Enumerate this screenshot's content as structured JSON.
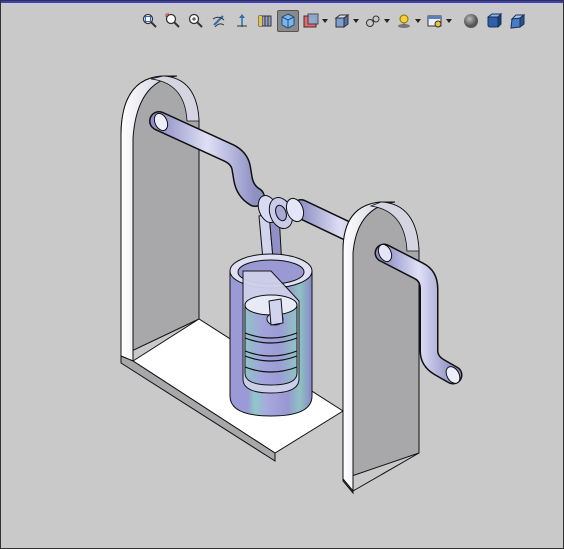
{
  "window": {
    "background": "#c9c9c9",
    "accent_line": "#3e3ec8"
  },
  "toolbar": {
    "buttons": [
      {
        "name": "zoom-to-fit-icon",
        "menu": false,
        "active": false
      },
      {
        "name": "zoom-to-area-icon",
        "menu": false,
        "active": false
      },
      {
        "name": "zoom-in-out-icon",
        "menu": false,
        "active": false
      },
      {
        "name": "rotate-view-icon",
        "menu": false,
        "active": false
      },
      {
        "name": "pan-icon",
        "menu": false,
        "active": false
      },
      {
        "name": "section-view-icon",
        "menu": false,
        "active": false
      },
      {
        "name": "view-orientation-icon",
        "menu": false,
        "active": true
      },
      {
        "name": "display-style-icon",
        "menu": true,
        "active": false
      },
      {
        "name": "hide-show-items-icon",
        "menu": true,
        "active": false
      },
      {
        "name": "edit-appearance-icon",
        "menu": true,
        "active": false
      },
      {
        "name": "apply-scene-icon",
        "menu": true,
        "active": false
      },
      {
        "name": "view-settings-icon",
        "menu": true,
        "active": false
      },
      {
        "name": "shaded-sphere-icon",
        "menu": false,
        "active": false
      },
      {
        "name": "shaded-cube-icon",
        "menu": false,
        "active": false
      },
      {
        "name": "perspective-cube-icon",
        "menu": false,
        "active": false
      }
    ]
  },
  "model": {
    "description_color_frame": "#b9b9bf",
    "frame_face": "#a9a9ad",
    "base_top": "#ffffff",
    "piston_blue": "#9d9ed6",
    "piston_teal": "#8fc3c6",
    "rod_color": "#c9cbe8"
  }
}
